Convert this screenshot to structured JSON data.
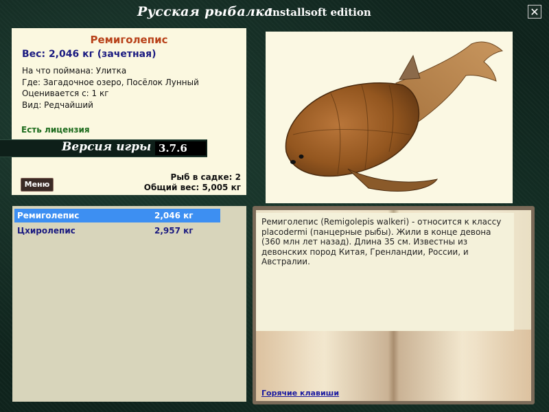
{
  "window": {
    "title": "Русская рыбалка",
    "edition": "Installsoft edition",
    "close_glyph": "✕"
  },
  "catch_info": {
    "fish_name": "Ремиголепис",
    "weight": "Вес: 2,046 кг (зачетная)",
    "bait": "На что поймана: Улитка",
    "location": "Где: Загадочное озеро, Посёлок Лунный",
    "rated_from": "Оценивается с: 1 кг",
    "rarity": "Вид: Редчайший",
    "license": "Есть лицензия",
    "fish_in_keepnet": "Рыб в садке: 2",
    "total_weight": "Общий вес: 5,005 кг",
    "menu_label": "Меню"
  },
  "version": {
    "label": "Версия игры",
    "value": "3.7.6"
  },
  "keepnet": {
    "items": [
      {
        "name": "Ремиголепис",
        "weight": "2,046 кг",
        "selected": true
      },
      {
        "name": "Цхиролепис",
        "weight": "2,957 кг",
        "selected": false
      }
    ]
  },
  "description": {
    "text": "Ремиголепис (Remigolepis walkeri) - относится к классу placodermi (панцерные рыбы). Жили в конце девона (360 млн лет назад). Длина 35 см. Известны из девонских пород Китая, Гренландии, России, и Австралии.",
    "hotkeys_link": "Горячие клавиши"
  },
  "colors": {
    "accent_selected": "#3d8ff2",
    "fish_name": "#b8421a",
    "license": "#1c6b1c",
    "link": "#1a1aa0"
  }
}
